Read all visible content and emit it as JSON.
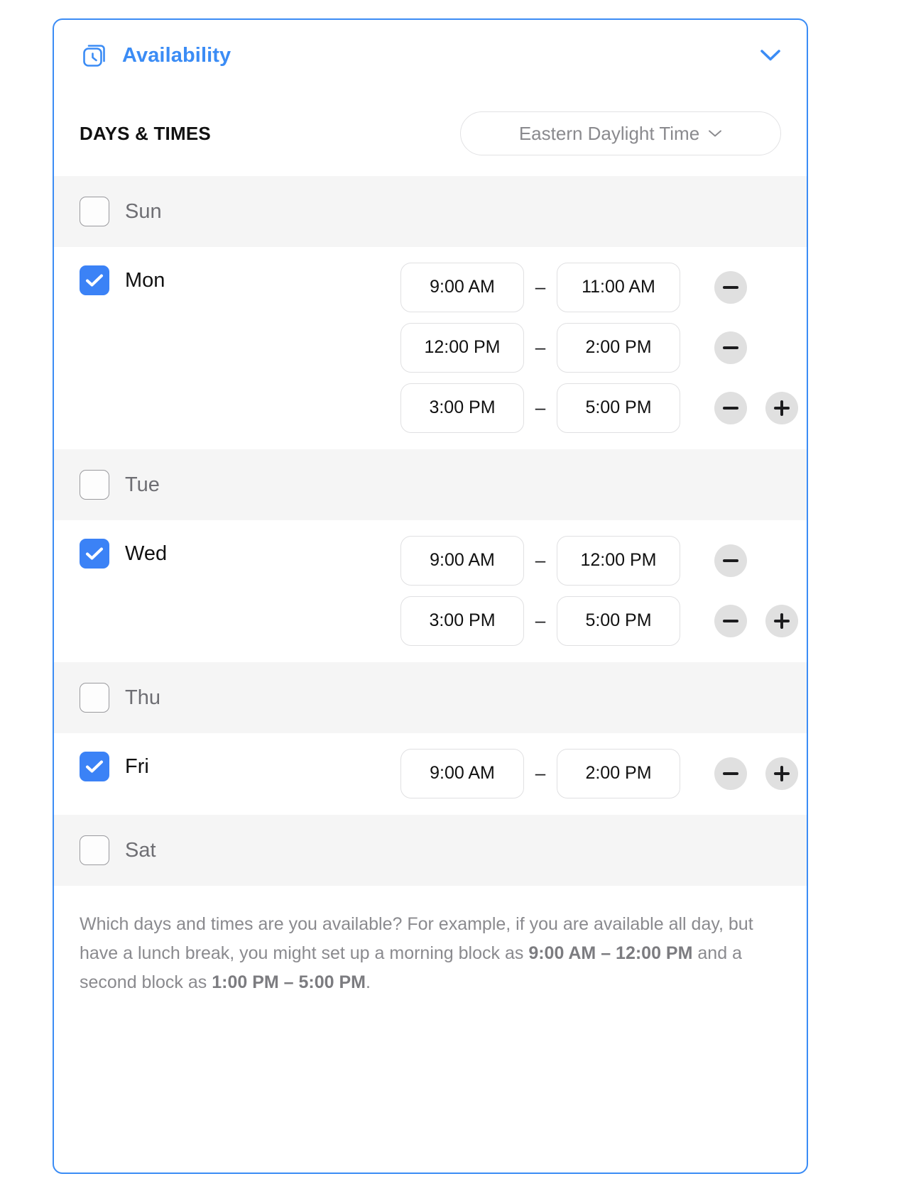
{
  "header": {
    "title": "Availability",
    "icon": "stacked-clock-icon",
    "collapse_icon": "chevron-down-icon",
    "accent_color": "#3b8cf5"
  },
  "section": {
    "label": "DAYS & TIMES",
    "timezone": {
      "value": "Eastern Daylight Time",
      "caret_icon": "chevron-down-icon"
    }
  },
  "separator": "–",
  "buttons": {
    "remove_label": "−",
    "add_label": "+",
    "remove_icon": "minus-icon",
    "add_icon": "plus-icon"
  },
  "days": [
    {
      "name": "Sun",
      "checked": false,
      "blocks": []
    },
    {
      "name": "Mon",
      "checked": true,
      "blocks": [
        {
          "start": "9:00 AM",
          "end": "11:00 AM",
          "has_add": false
        },
        {
          "start": "12:00 PM",
          "end": "2:00 PM",
          "has_add": false
        },
        {
          "start": "3:00 PM",
          "end": "5:00 PM",
          "has_add": true
        }
      ]
    },
    {
      "name": "Tue",
      "checked": false,
      "blocks": []
    },
    {
      "name": "Wed",
      "checked": true,
      "blocks": [
        {
          "start": "9:00 AM",
          "end": "12:00 PM",
          "has_add": false
        },
        {
          "start": "3:00 PM",
          "end": "5:00 PM",
          "has_add": true
        }
      ]
    },
    {
      "name": "Thu",
      "checked": false,
      "blocks": []
    },
    {
      "name": "Fri",
      "checked": true,
      "blocks": [
        {
          "start": "9:00 AM",
          "end": "2:00 PM",
          "has_add": true
        }
      ]
    },
    {
      "name": "Sat",
      "checked": false,
      "blocks": []
    }
  ],
  "footer": {
    "part1": "Which days and times are you available? For example, if you are available all day, but have a lunch break, you might set up a morning block as ",
    "bold1": "9:00 AM – 12:00 PM",
    "part2": " and a second block as ",
    "bold2": "1:00 PM – 5:00 PM",
    "part3": "."
  }
}
